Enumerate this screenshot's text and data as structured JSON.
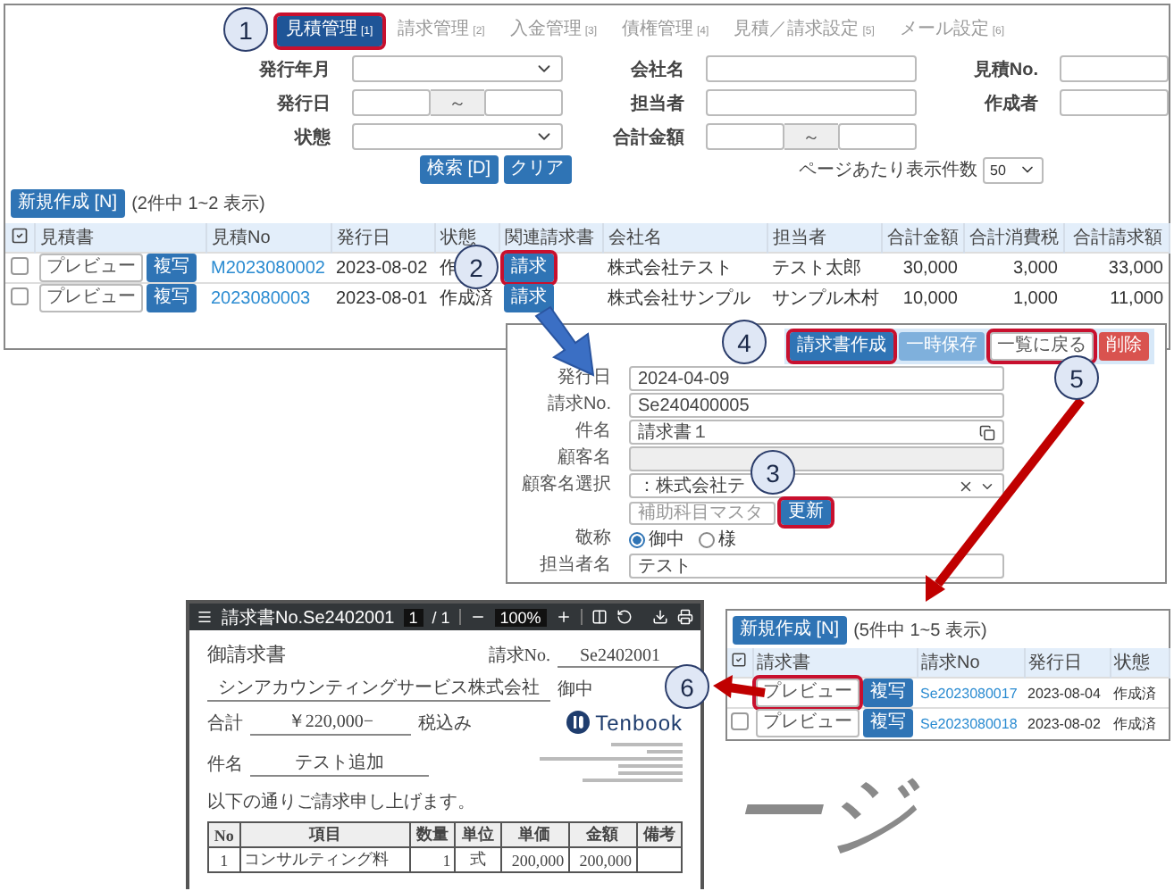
{
  "estimate_list": {
    "tabs": [
      {
        "label": "見積管理",
        "key": "[1]",
        "selected": true,
        "highlighted": true
      },
      {
        "label": "請求管理",
        "key": "[2]",
        "selected": false,
        "highlighted": false
      },
      {
        "label": "入金管理",
        "key": "[3]",
        "selected": false,
        "highlighted": false
      },
      {
        "label": "債権管理",
        "key": "[4]",
        "selected": false,
        "highlighted": false
      },
      {
        "label": "見積／請求設定",
        "key": "[5]",
        "selected": false,
        "highlighted": false
      },
      {
        "label": "メール設定",
        "key": "[6]",
        "selected": false,
        "highlighted": false
      }
    ],
    "filters": [
      {
        "label": "発行年月",
        "kind": "select"
      },
      {
        "label": "会社名",
        "kind": "text"
      },
      {
        "label": "見積No.",
        "kind": "text"
      },
      {
        "label": "発行日",
        "kind": "range",
        "separator": "～"
      },
      {
        "label": "担当者",
        "kind": "text"
      },
      {
        "label": "作成者",
        "kind": "text"
      },
      {
        "label": "状態",
        "kind": "select"
      },
      {
        "label": "合計金額",
        "kind": "range",
        "separator": "～"
      }
    ],
    "search_button": "検索 [D]",
    "clear_button": "クリア",
    "per_page": {
      "label": "ページあたり表示件数",
      "value": "50"
    },
    "new_button": "新規作成 [N]",
    "count": "(2件中 1~2 表示)",
    "columns": [
      "見積書",
      "見積No",
      "発行日",
      "状態",
      "関連請求書",
      "会社名",
      "担当者",
      "合計金額",
      "合計消費税",
      "合計請求額"
    ],
    "rows": [
      {
        "checked": false,
        "preview": "プレビュー",
        "copy": "複写",
        "number": "M2023080002",
        "date": "2023-08-02",
        "status": "作",
        "related": {
          "label": "請求",
          "highlighted": true
        },
        "company": "株式会社テスト",
        "person": "テスト太郎",
        "amount": "30,000",
        "tax": "3,000",
        "total": "33,000"
      },
      {
        "checked": false,
        "preview": "プレビュー",
        "copy": "複写",
        "number": "2023080003",
        "date": "2023-08-01",
        "status": "作成済",
        "related": {
          "label": "請求",
          "highlighted": false
        },
        "company": "株式会社サンプル",
        "person": "サンプル木村",
        "amount": "10,000",
        "tax": "1,000",
        "total": "11,000"
      }
    ]
  },
  "invoice_form": {
    "toolbar": [
      {
        "label": "請求書作成",
        "kind": "primary",
        "highlighted": true
      },
      {
        "label": "一時保存",
        "kind": "light",
        "highlighted": false
      },
      {
        "label": "一覧に戻る",
        "kind": "plain",
        "highlighted": true
      },
      {
        "label": "削除",
        "kind": "danger",
        "highlighted": false
      }
    ],
    "fields": [
      {
        "label": "発行日",
        "kind": "text",
        "value": "2024-04-09"
      },
      {
        "label": "請求No.",
        "kind": "text",
        "value": "Se240400005"
      },
      {
        "label": "件名",
        "kind": "text_copy",
        "value": "請求書１"
      },
      {
        "label": "顧客名",
        "kind": "disabled"
      },
      {
        "label": "顧客名選択",
        "kind": "select",
        "value": "：株式会社テ",
        "sub_placeholder": "補助科目マスタ",
        "sub_button": {
          "label": "更新",
          "highlighted": true
        }
      },
      {
        "label": "敬称",
        "kind": "radio",
        "options": [
          {
            "label": "御中",
            "selected": true
          },
          {
            "label": "様",
            "selected": false
          }
        ]
      },
      {
        "label": "担当者名",
        "kind": "text",
        "value": "テスト"
      }
    ]
  },
  "pdf_viewer": {
    "title": "請求書No.Se2402001",
    "page": "1",
    "page_count": "/ 1",
    "zoom": "100%",
    "document": {
      "heading": "御請求書",
      "number_label": "請求No.",
      "number": "Se2402001",
      "customer": "シンアカウンティングサービス株式会社",
      "customer_suffix": "御中",
      "total_label": "合計",
      "total": "￥220,000−",
      "total_suffix": "税込み",
      "subject_label": "件名",
      "subject": "テスト追加",
      "logo": "Tenbook",
      "intro": "以下の通りご請求申し上げます。",
      "columns": [
        "No",
        "項目",
        "数量",
        "単位",
        "単価",
        "金額",
        "備考"
      ],
      "rows": [
        {
          "cells": [
            "1",
            "コンサルティング料",
            "1",
            "式",
            "200,000",
            "200,000"
          ]
        }
      ]
    }
  },
  "invoice_list": {
    "new_button": "新規作成 [N]",
    "count": "(5件中 1~5 表示)",
    "columns": [
      "請求書",
      "請求No",
      "発行日",
      "状態"
    ],
    "rows": [
      {
        "preview": {
          "label": "プレビュー",
          "highlighted": true
        },
        "copy": "複写",
        "number": "Se2023080017",
        "date": "2023-08-04",
        "status": "作成済"
      },
      {
        "checked": false,
        "preview": {
          "label": "プレビュー",
          "highlighted": false
        },
        "copy": "複写",
        "number": "Se2023080018",
        "date": "2023-08-02",
        "status": "作成済"
      }
    ]
  },
  "background_text": "ージ",
  "callouts": [
    "1",
    "2",
    "3",
    "4",
    "5",
    "6"
  ]
}
